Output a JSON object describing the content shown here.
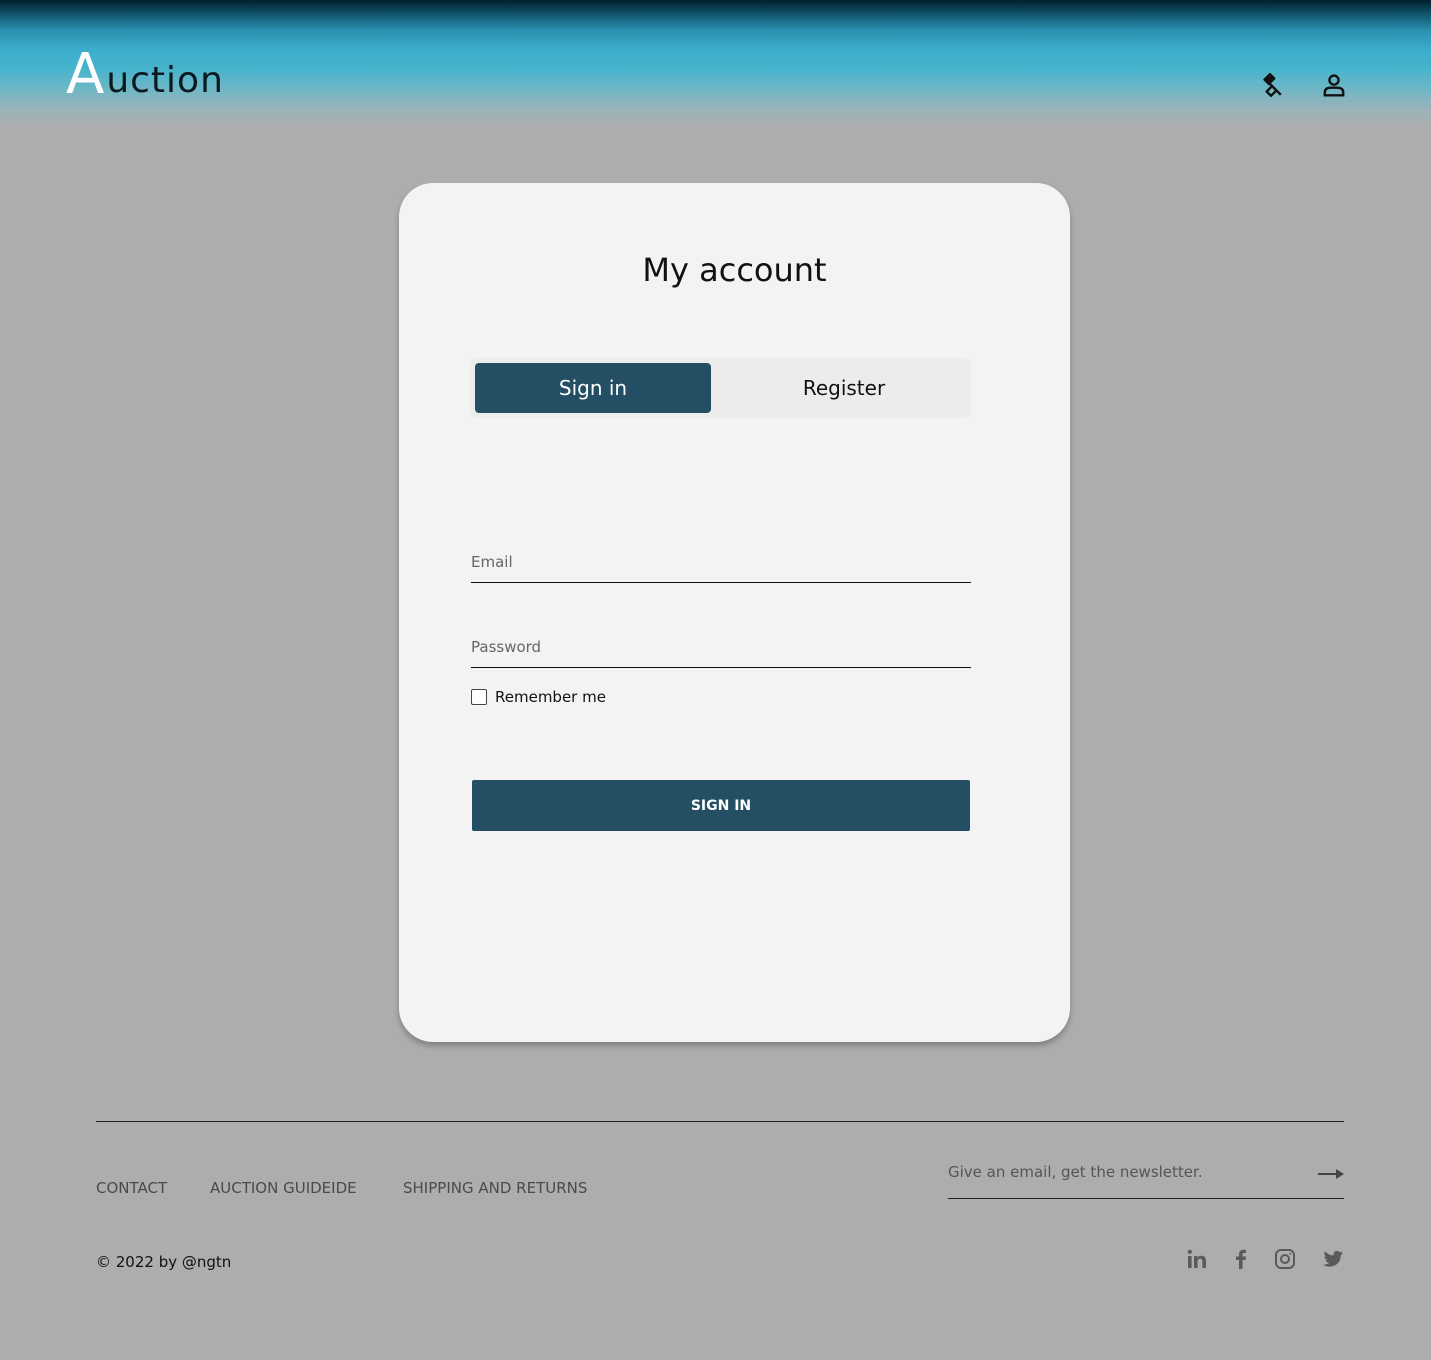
{
  "header": {
    "logo_initial": "A",
    "logo_rest": "uction",
    "icons": [
      "gavel-icon",
      "user-icon"
    ]
  },
  "card": {
    "title": "My account",
    "tabs": [
      {
        "label": "Sign in",
        "active": true
      },
      {
        "label": "Register",
        "active": false
      }
    ],
    "email_placeholder": "Email",
    "password_placeholder": "Password",
    "remember_label": "Remember me",
    "remember_checked": false,
    "submit_label": "SIGN IN"
  },
  "footer": {
    "links": [
      "CONTACT",
      "AUCTION GUIDEIDE",
      "SHIPPING AND RETURNS"
    ],
    "newsletter_placeholder": "Give an email, get the newsletter.",
    "copyright": "© 2022 by @ngtn",
    "social_icons": [
      "linkedin-icon",
      "facebook-icon",
      "instagram-icon",
      "twitter-icon"
    ]
  },
  "colors": {
    "background": "#adadad",
    "accent": "#244e63",
    "card": "#f3f3f3",
    "header_teal": "#3caecb"
  }
}
